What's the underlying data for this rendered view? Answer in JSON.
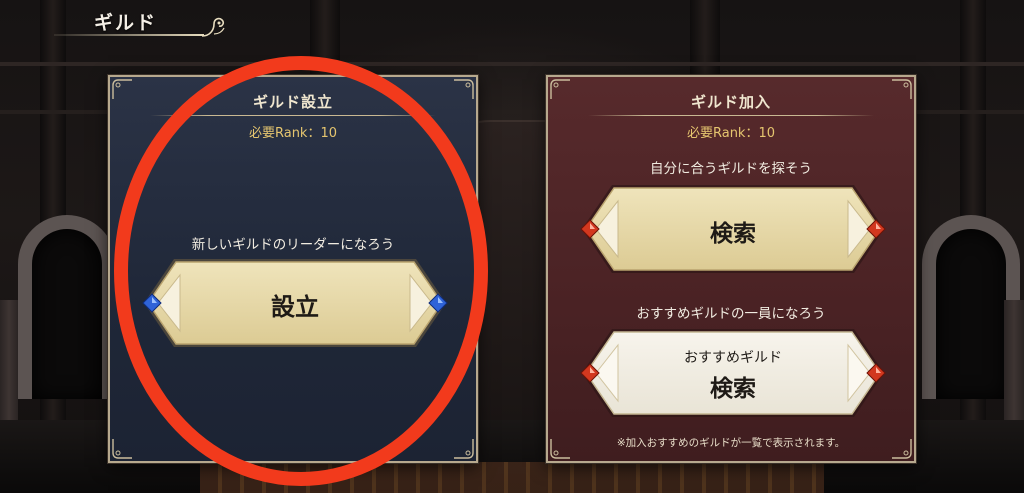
{
  "header": {
    "title": "ギルド"
  },
  "left_panel": {
    "title": "ギルド設立",
    "rank": "必要Rank：10",
    "caption": "新しいギルドのリーダーになろう",
    "button_label": "設立"
  },
  "right_panel": {
    "title": "ギルド加入",
    "rank": "必要Rank：10",
    "search_caption": "自分に合うギルドを探そう",
    "search_button_label": "検索",
    "recommend_caption": "おすすめギルドの一員になろう",
    "recommend_button_sublabel": "おすすめギルド",
    "recommend_button_label": "検索",
    "note": "※加入おすすめのギルドが一覧で表示されます。"
  },
  "colors": {
    "left_panel_bg": "#242c3e",
    "right_panel_bg": "#4e2426",
    "rank_text": "#e5c56f",
    "button_gold": "#e9dcae",
    "button_white": "#f2efe6",
    "gem_blue": "#2f63d8",
    "gem_red": "#d2381f",
    "annotation_red": "#f23a1c"
  },
  "icons": {
    "header_flourish": "ornament-flourish-icon",
    "gem_left_panel": "blue-gem-icon",
    "gem_right_panel": "red-gem-icon"
  }
}
